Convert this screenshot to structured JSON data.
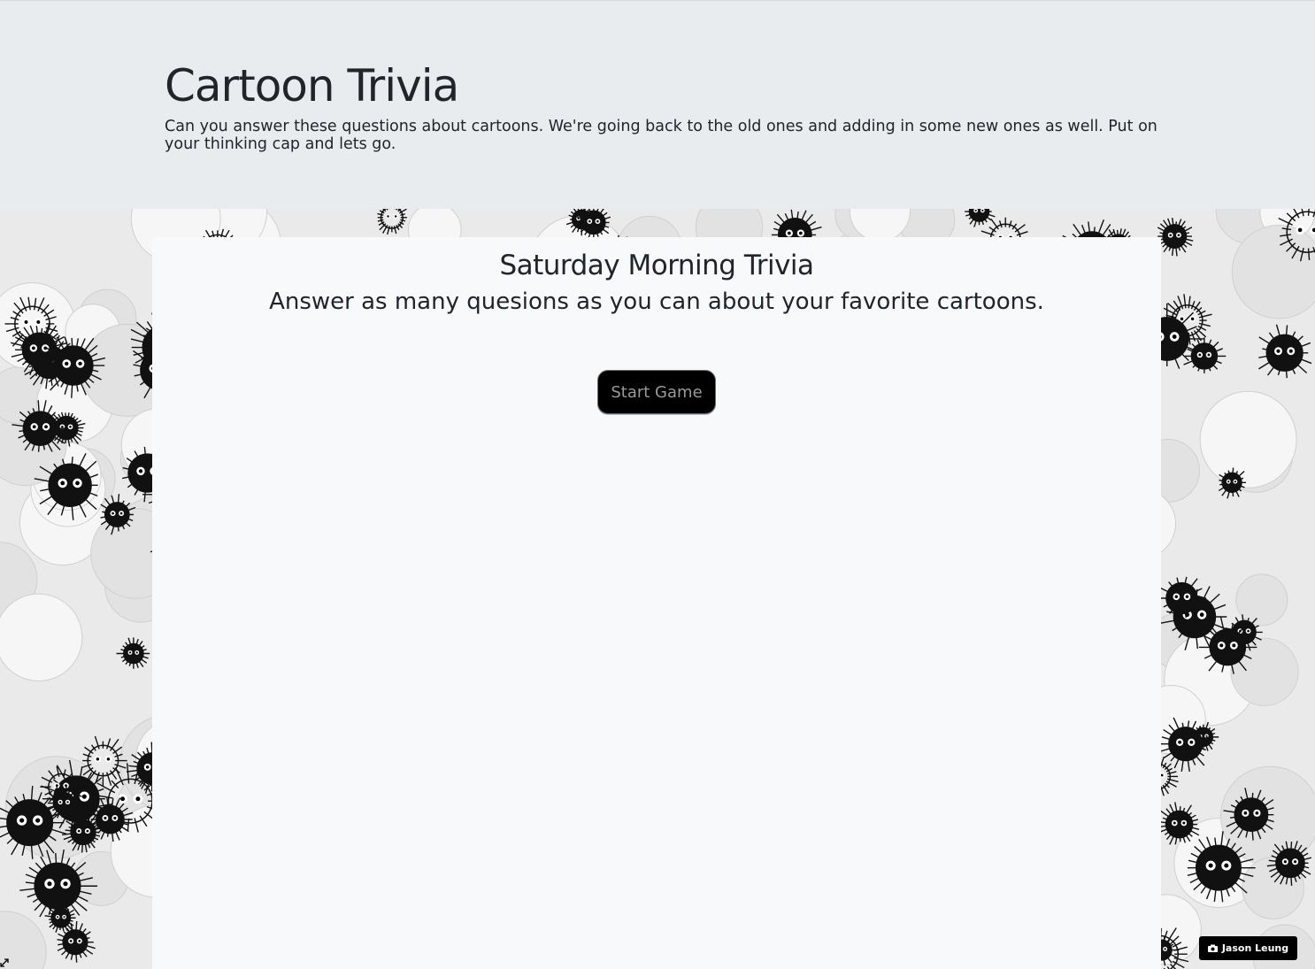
{
  "header": {
    "title": "Cartoon Trivia",
    "lead": "Can you answer these questions about cartoons. We're going back to the old ones and adding in some new ones as well. Put on your thinking cap and lets go."
  },
  "game": {
    "title": "Saturday Morning Trivia",
    "subtitle": "Answer as many quesions as you can about your favorite cartoons.",
    "start_label": "Start Game"
  },
  "credit": {
    "icon": "camera-icon",
    "name": "Jason Leung"
  },
  "colors": {
    "header_bg": "#e9ecef",
    "card_bg": "#f8f9fa",
    "button_bg": "#000000",
    "button_text": "#9a9a9a",
    "text": "#212529"
  }
}
